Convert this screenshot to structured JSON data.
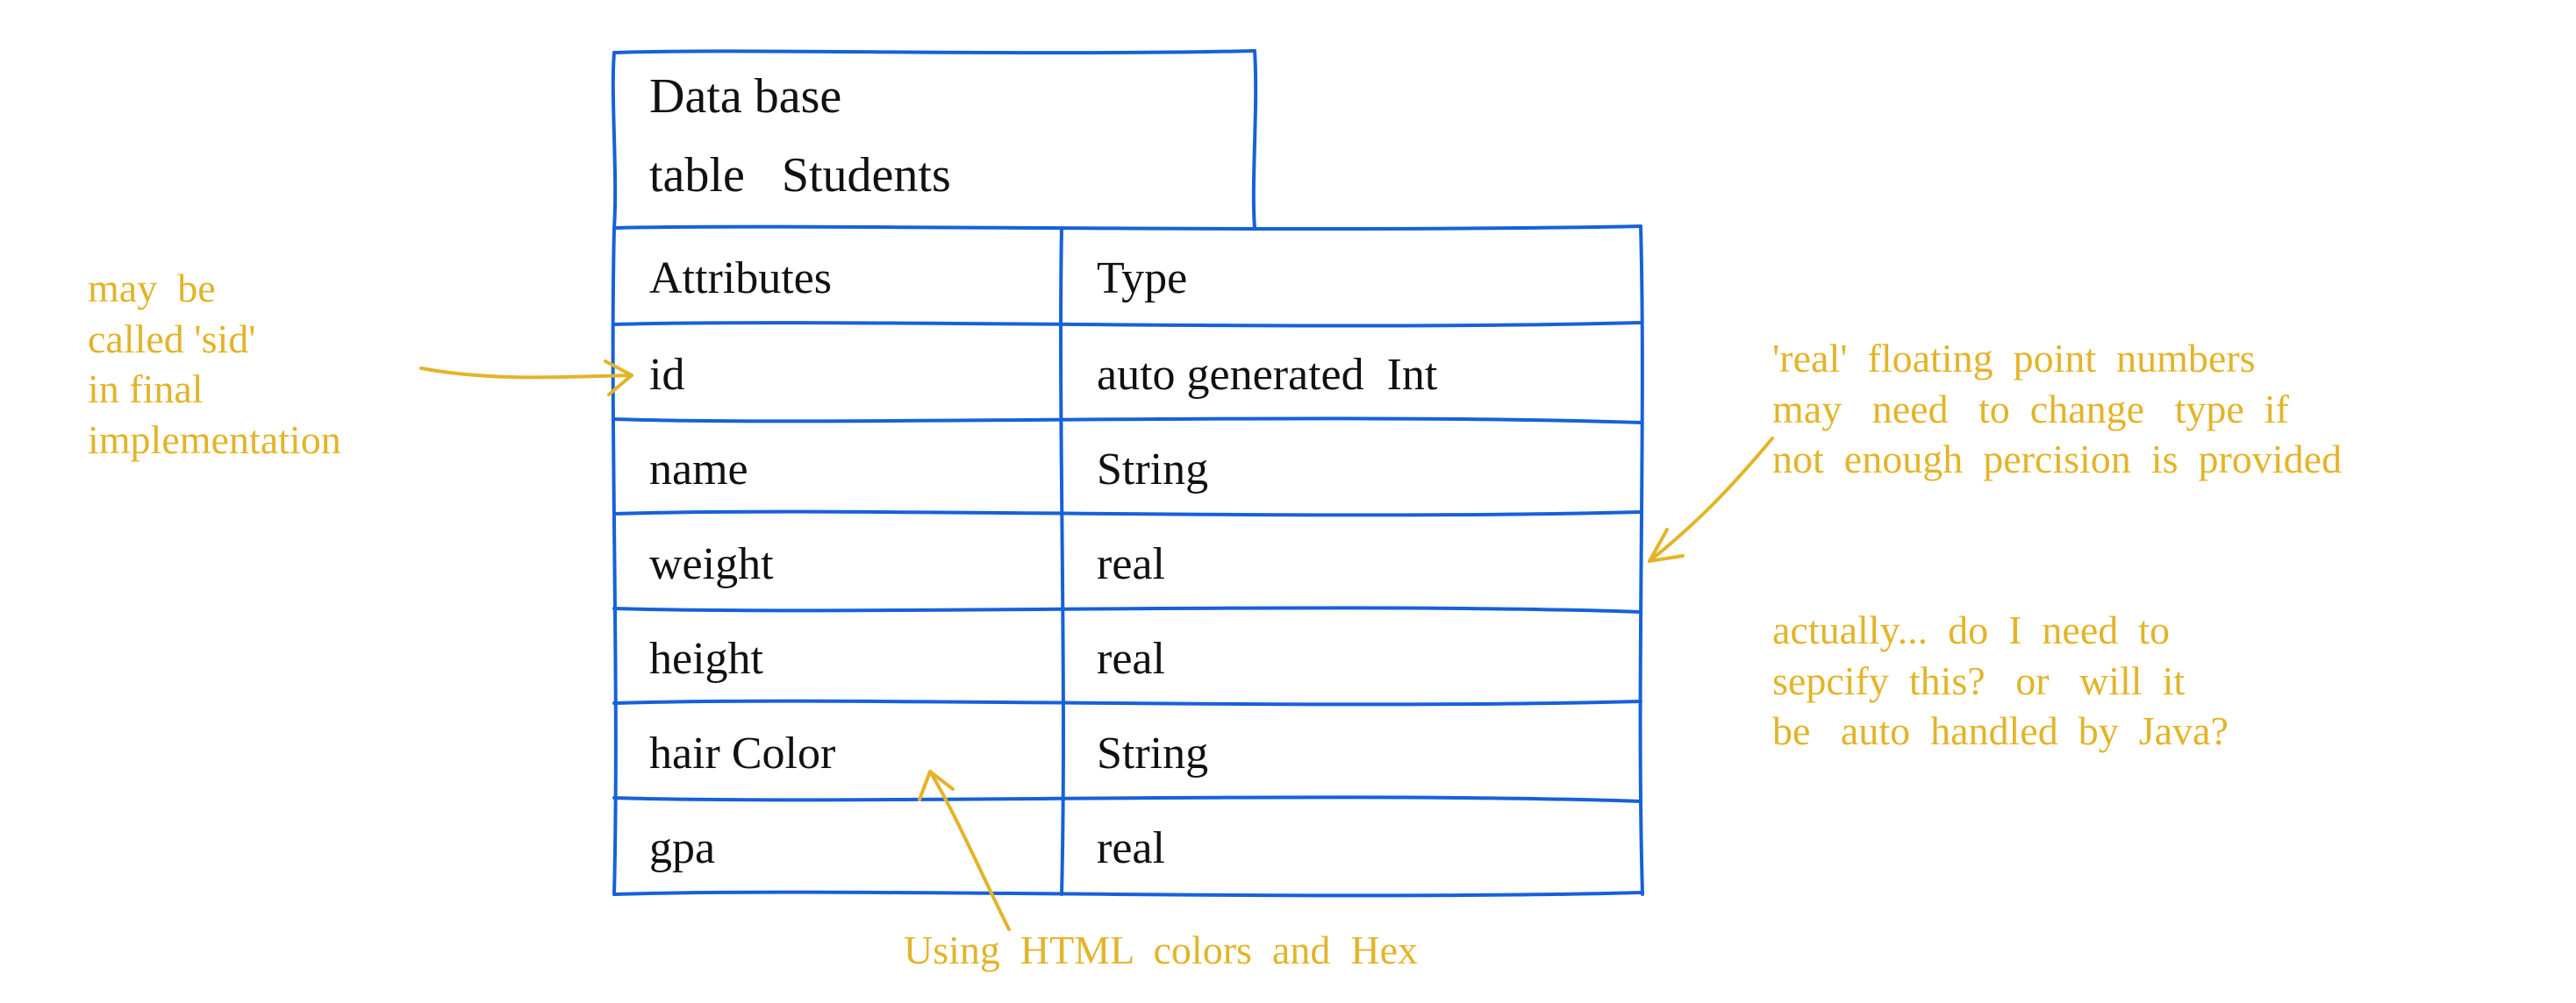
{
  "table": {
    "title_line1": "Data base",
    "title_line2": "table   Students",
    "header_attr": "Attributes",
    "header_type": "Type",
    "rows": [
      {
        "attr": "id",
        "type": "auto generated  Int"
      },
      {
        "attr": "name",
        "type": "String"
      },
      {
        "attr": "weight",
        "type": "real"
      },
      {
        "attr": "height",
        "type": "real"
      },
      {
        "attr": "hair Color",
        "type": "String"
      },
      {
        "attr": "gpa",
        "type": "real"
      }
    ]
  },
  "notes": {
    "left_sid": "may  be\ncalled 'sid'\nin final\nimplementation",
    "bottom_colors": "Using  HTML  colors  and  Hex",
    "right_real": "'real'  floating  point  numbers\nmay   need   to  change   type  if\nnot  enough  percision  is  provided",
    "right_question": "actually...  do  I  need  to\nsepcify  this?   or   will  it\nbe   auto  handled  by  Java?"
  }
}
